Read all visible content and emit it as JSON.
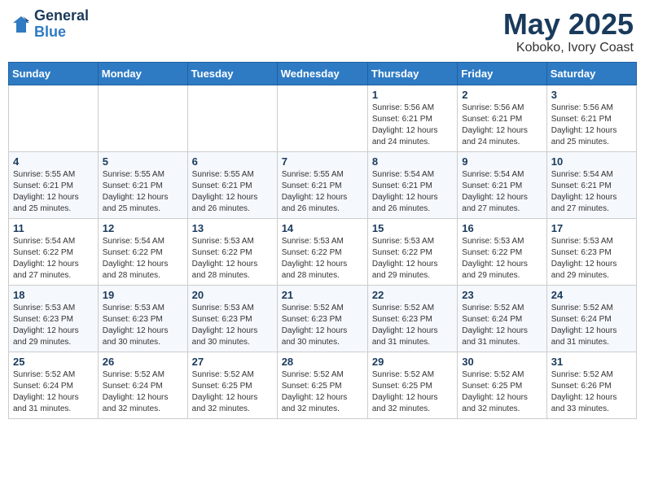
{
  "header": {
    "logo_general": "General",
    "logo_blue": "Blue",
    "month_year": "May 2025",
    "location": "Koboko, Ivory Coast"
  },
  "weekdays": [
    "Sunday",
    "Monday",
    "Tuesday",
    "Wednesday",
    "Thursday",
    "Friday",
    "Saturday"
  ],
  "weeks": [
    [
      {
        "day": "",
        "info": ""
      },
      {
        "day": "",
        "info": ""
      },
      {
        "day": "",
        "info": ""
      },
      {
        "day": "",
        "info": ""
      },
      {
        "day": "1",
        "info": "Sunrise: 5:56 AM\nSunset: 6:21 PM\nDaylight: 12 hours\nand 24 minutes."
      },
      {
        "day": "2",
        "info": "Sunrise: 5:56 AM\nSunset: 6:21 PM\nDaylight: 12 hours\nand 24 minutes."
      },
      {
        "day": "3",
        "info": "Sunrise: 5:56 AM\nSunset: 6:21 PM\nDaylight: 12 hours\nand 25 minutes."
      }
    ],
    [
      {
        "day": "4",
        "info": "Sunrise: 5:55 AM\nSunset: 6:21 PM\nDaylight: 12 hours\nand 25 minutes."
      },
      {
        "day": "5",
        "info": "Sunrise: 5:55 AM\nSunset: 6:21 PM\nDaylight: 12 hours\nand 25 minutes."
      },
      {
        "day": "6",
        "info": "Sunrise: 5:55 AM\nSunset: 6:21 PM\nDaylight: 12 hours\nand 26 minutes."
      },
      {
        "day": "7",
        "info": "Sunrise: 5:55 AM\nSunset: 6:21 PM\nDaylight: 12 hours\nand 26 minutes."
      },
      {
        "day": "8",
        "info": "Sunrise: 5:54 AM\nSunset: 6:21 PM\nDaylight: 12 hours\nand 26 minutes."
      },
      {
        "day": "9",
        "info": "Sunrise: 5:54 AM\nSunset: 6:21 PM\nDaylight: 12 hours\nand 27 minutes."
      },
      {
        "day": "10",
        "info": "Sunrise: 5:54 AM\nSunset: 6:21 PM\nDaylight: 12 hours\nand 27 minutes."
      }
    ],
    [
      {
        "day": "11",
        "info": "Sunrise: 5:54 AM\nSunset: 6:22 PM\nDaylight: 12 hours\nand 27 minutes."
      },
      {
        "day": "12",
        "info": "Sunrise: 5:54 AM\nSunset: 6:22 PM\nDaylight: 12 hours\nand 28 minutes."
      },
      {
        "day": "13",
        "info": "Sunrise: 5:53 AM\nSunset: 6:22 PM\nDaylight: 12 hours\nand 28 minutes."
      },
      {
        "day": "14",
        "info": "Sunrise: 5:53 AM\nSunset: 6:22 PM\nDaylight: 12 hours\nand 28 minutes."
      },
      {
        "day": "15",
        "info": "Sunrise: 5:53 AM\nSunset: 6:22 PM\nDaylight: 12 hours\nand 29 minutes."
      },
      {
        "day": "16",
        "info": "Sunrise: 5:53 AM\nSunset: 6:22 PM\nDaylight: 12 hours\nand 29 minutes."
      },
      {
        "day": "17",
        "info": "Sunrise: 5:53 AM\nSunset: 6:23 PM\nDaylight: 12 hours\nand 29 minutes."
      }
    ],
    [
      {
        "day": "18",
        "info": "Sunrise: 5:53 AM\nSunset: 6:23 PM\nDaylight: 12 hours\nand 29 minutes."
      },
      {
        "day": "19",
        "info": "Sunrise: 5:53 AM\nSunset: 6:23 PM\nDaylight: 12 hours\nand 30 minutes."
      },
      {
        "day": "20",
        "info": "Sunrise: 5:53 AM\nSunset: 6:23 PM\nDaylight: 12 hours\nand 30 minutes."
      },
      {
        "day": "21",
        "info": "Sunrise: 5:52 AM\nSunset: 6:23 PM\nDaylight: 12 hours\nand 30 minutes."
      },
      {
        "day": "22",
        "info": "Sunrise: 5:52 AM\nSunset: 6:23 PM\nDaylight: 12 hours\nand 31 minutes."
      },
      {
        "day": "23",
        "info": "Sunrise: 5:52 AM\nSunset: 6:24 PM\nDaylight: 12 hours\nand 31 minutes."
      },
      {
        "day": "24",
        "info": "Sunrise: 5:52 AM\nSunset: 6:24 PM\nDaylight: 12 hours\nand 31 minutes."
      }
    ],
    [
      {
        "day": "25",
        "info": "Sunrise: 5:52 AM\nSunset: 6:24 PM\nDaylight: 12 hours\nand 31 minutes."
      },
      {
        "day": "26",
        "info": "Sunrise: 5:52 AM\nSunset: 6:24 PM\nDaylight: 12 hours\nand 32 minutes."
      },
      {
        "day": "27",
        "info": "Sunrise: 5:52 AM\nSunset: 6:25 PM\nDaylight: 12 hours\nand 32 minutes."
      },
      {
        "day": "28",
        "info": "Sunrise: 5:52 AM\nSunset: 6:25 PM\nDaylight: 12 hours\nand 32 minutes."
      },
      {
        "day": "29",
        "info": "Sunrise: 5:52 AM\nSunset: 6:25 PM\nDaylight: 12 hours\nand 32 minutes."
      },
      {
        "day": "30",
        "info": "Sunrise: 5:52 AM\nSunset: 6:25 PM\nDaylight: 12 hours\nand 32 minutes."
      },
      {
        "day": "31",
        "info": "Sunrise: 5:52 AM\nSunset: 6:26 PM\nDaylight: 12 hours\nand 33 minutes."
      }
    ]
  ]
}
